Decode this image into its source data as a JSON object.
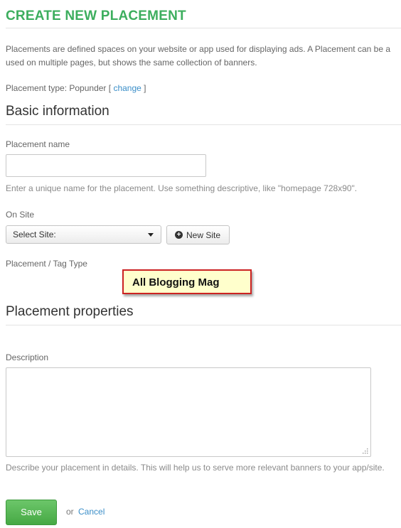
{
  "page": {
    "title": "CREATE NEW PLACEMENT",
    "intro_line1": "Placements are defined spaces on your website or app used for displaying ads. A Placement can be a",
    "intro_line2": "used on multiple pages, but shows the same collection of banners."
  },
  "placement_type": {
    "label": "Placement type: Popunder [ ",
    "change_link": "change",
    "suffix": " ]"
  },
  "basic_info": {
    "heading": "Basic information",
    "name_label": "Placement name",
    "name_value": "",
    "name_hint": "Enter a unique name for the placement. Use something descriptive, like \"homepage 728x90\".",
    "site_label": "On Site",
    "site_select": "Select Site:",
    "new_site_button": "New Site",
    "tag_type_label": "Placement / Tag Type"
  },
  "tooltip": {
    "text": "All Blogging Mag"
  },
  "properties": {
    "heading": "Placement properties",
    "description_label": "Description",
    "description_value": "",
    "description_hint": "Describe your placement in details. This will help us to serve more relevant banners to your app/site."
  },
  "actions": {
    "save_label": "Save",
    "or_text": "or",
    "cancel_label": "Cancel"
  },
  "colors": {
    "title_green": "#3dae5e",
    "link_blue": "#3a8ec8",
    "save_green": "#56b854",
    "tooltip_bg": "#ffffcc",
    "tooltip_border": "#cc2222"
  }
}
